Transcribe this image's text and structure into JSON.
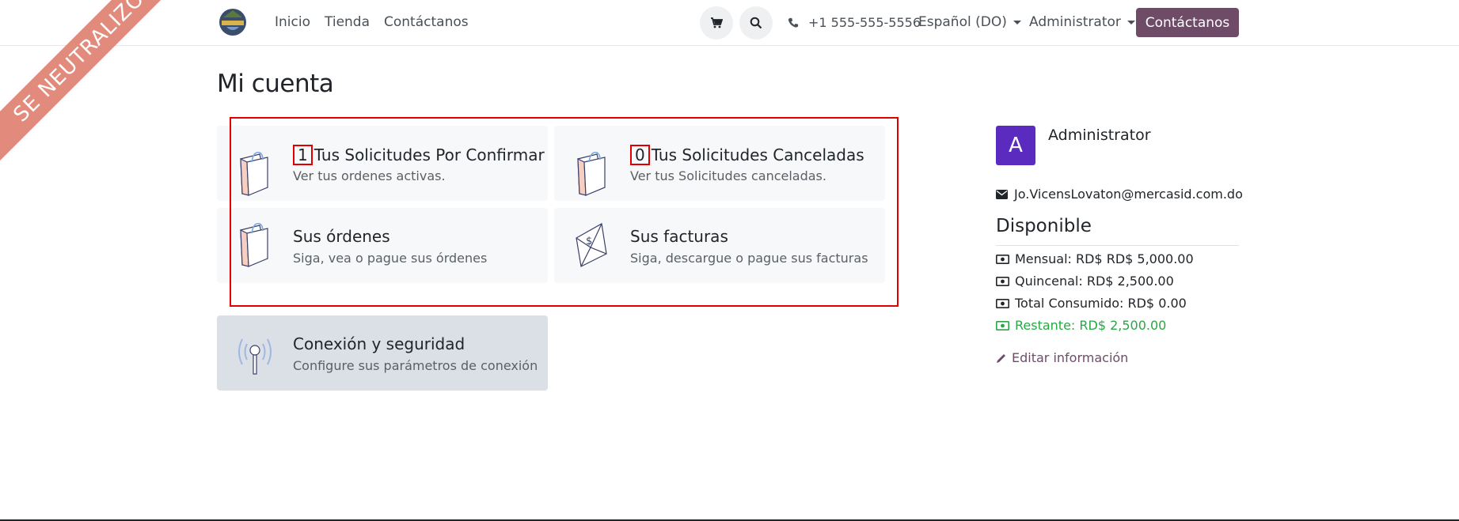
{
  "ribbon": {
    "text": "SE NEUTRALIZO"
  },
  "header": {
    "nav": [
      "Inicio",
      "Tienda",
      "Contáctanos"
    ],
    "phone": "+1 555-555-5556",
    "language": "Español (DO)",
    "user_menu": "Administrator",
    "contact_button": "Contáctanos"
  },
  "page": {
    "title": "Mi cuenta"
  },
  "cards": {
    "pending": {
      "count": "1",
      "title": "Tus Solicitudes Por Confirmar",
      "subtitle": "Ver tus ordenes activas."
    },
    "cancelled": {
      "count": "0",
      "title": "Tus Solicitudes Canceladas",
      "subtitle": "Ver tus Solicitudes canceladas."
    },
    "orders": {
      "title": "Sus órdenes",
      "subtitle": "Siga, vea o pague sus órdenes"
    },
    "invoices": {
      "title": "Sus facturas",
      "subtitle": "Siga, descargue o pague sus facturas"
    },
    "security": {
      "title": "Conexión y seguridad",
      "subtitle": "Configure sus parámetros de conexión"
    }
  },
  "profile": {
    "avatar_letter": "A",
    "name": "Administrator",
    "email": "Jo.VicensLovaton@mercasid.com.do",
    "available_title": "Disponible",
    "monthly": "Mensual: RD$ RD$ 5,000.00",
    "biweekly": "Quincenal: RD$ 2,500.00",
    "consumed": "Total Consumido: RD$ 0.00",
    "remaining": "Restante: RD$ 2,500.00",
    "edit_link": "Editar información"
  },
  "colors": {
    "brand": "#6e4c68",
    "avatar": "#5b2bbf",
    "highlight": "#e00000",
    "success": "#28a745"
  }
}
